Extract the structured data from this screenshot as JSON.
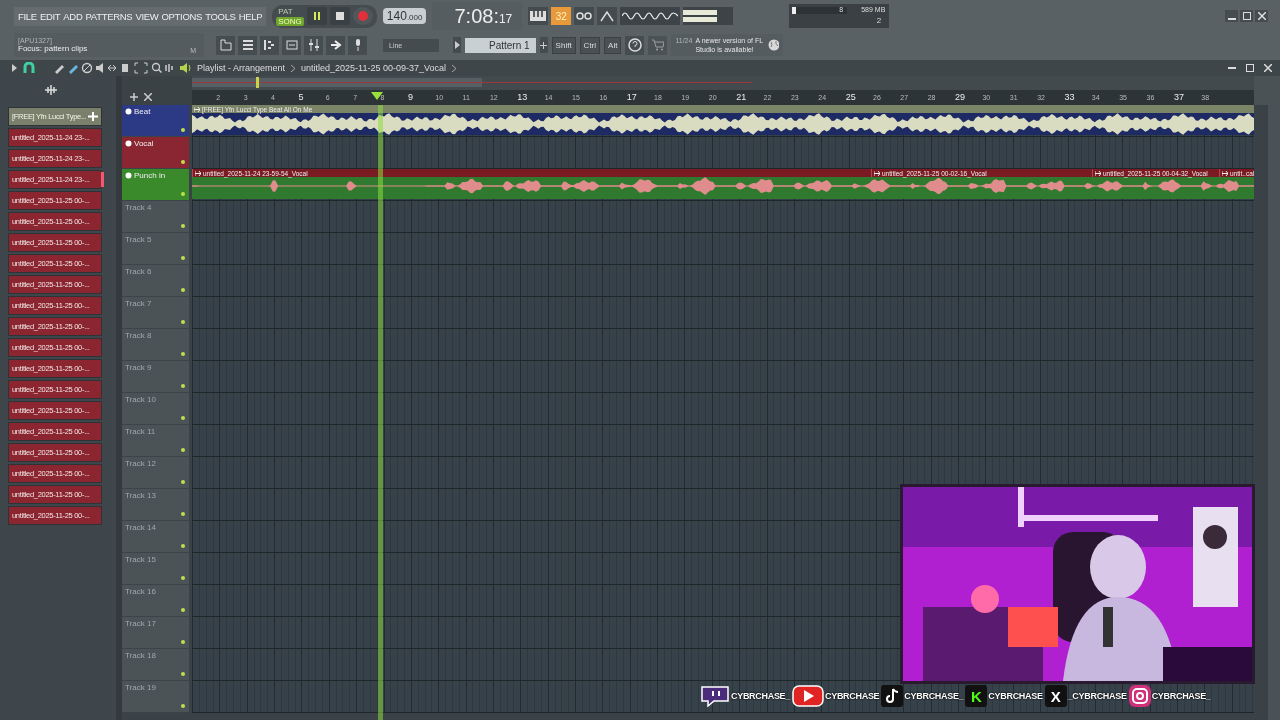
{
  "menu": [
    "FILE",
    "EDIT",
    "ADD",
    "PATTERNS",
    "VIEW",
    "OPTIONS",
    "TOOLS",
    "HELP"
  ],
  "mode": [
    {
      "label": "PAT",
      "selected": false
    },
    {
      "label": "SONG",
      "selected": true
    }
  ],
  "transport": {
    "playing": true
  },
  "tempo": "140",
  "tempo_decimals": ".000",
  "time": "7:08:",
  "time_small": "17",
  "snap_badge": "32",
  "cpu": {
    "voices": "8",
    "memory": "589 MB",
    "polyphony": "2",
    "level": 0.06
  },
  "hint": {
    "code": "[APU1327]",
    "text": "Focus: pattern clips",
    "mark": "M"
  },
  "snap": "Line",
  "pattern": "Pattern 1",
  "modifiers": [
    "Shift",
    "Ctrl",
    "Alt"
  ],
  "news": {
    "date": "11/24",
    "text": "A newer version of FL Studio is available!"
  },
  "playlist": {
    "title": "Playlist - Arrangement",
    "project": "untitled_2025-11-25 00-09-37_Vocal"
  },
  "picker": [
    {
      "label": "[FREE] Yfn Lucci Type...",
      "kind": "audio",
      "selected": false
    },
    {
      "label": "untitled_2025-11-24 23-...",
      "kind": "clip",
      "selected": false
    },
    {
      "label": "untitled_2025-11-24 23-...",
      "kind": "clip",
      "selected": false
    },
    {
      "label": "untitled_2025-11-24 23-...",
      "kind": "clip",
      "selected": true
    },
    {
      "label": "untitled_2025-11-25 00-...",
      "kind": "clip",
      "selected": false
    },
    {
      "label": "untitled_2025-11-25 00-...",
      "kind": "clip",
      "selected": false
    },
    {
      "label": "untitled_2025-11-25 00-...",
      "kind": "clip",
      "selected": false
    },
    {
      "label": "untitled_2025-11-25 00-...",
      "kind": "clip",
      "selected": false
    },
    {
      "label": "untitled_2025-11-25 00-...",
      "kind": "clip",
      "selected": false
    },
    {
      "label": "untitled_2025-11-25 00-...",
      "kind": "clip",
      "selected": false
    },
    {
      "label": "untitled_2025-11-25 00-...",
      "kind": "clip",
      "selected": false
    },
    {
      "label": "untitled_2025-11-25 00-...",
      "kind": "clip",
      "selected": false
    },
    {
      "label": "untitled_2025-11-25 00-...",
      "kind": "clip",
      "selected": false
    },
    {
      "label": "untitled_2025-11-25 00-...",
      "kind": "clip",
      "selected": false
    },
    {
      "label": "untitled_2025-11-25 00-...",
      "kind": "clip",
      "selected": false
    },
    {
      "label": "untitled_2025-11-25 00-...",
      "kind": "clip",
      "selected": false
    },
    {
      "label": "untitled_2025-11-25 00-...",
      "kind": "clip",
      "selected": false
    },
    {
      "label": "untitled_2025-11-25 00-...",
      "kind": "clip",
      "selected": false
    },
    {
      "label": "untitled_2025-11-25 00-...",
      "kind": "clip",
      "selected": false
    },
    {
      "label": "untitled_2025-11-25 00-...",
      "kind": "clip",
      "selected": false
    }
  ],
  "ruler": [
    "2",
    "3",
    "4",
    "5",
    "6",
    "7",
    "8",
    "9",
    "10",
    "11",
    "12",
    "13",
    "14",
    "15",
    "16",
    "17",
    "18",
    "19",
    "20",
    "21",
    "22",
    "23",
    "24",
    "25",
    "26",
    "27",
    "28",
    "29",
    "30",
    "31",
    "32",
    "33",
    "34",
    "35",
    "36",
    "37",
    "38"
  ],
  "tracks": [
    {
      "name": "Beat",
      "color": "#2c3a86",
      "clips": [
        {
          "label": "[FREE] Yfn Lucci Type Beat All On Me",
          "kind": "beat"
        }
      ]
    },
    {
      "name": "Vocal",
      "color": "#8a2632"
    },
    {
      "name": "Punch in",
      "color": "#3a8a2c",
      "clips": [
        {
          "label": "untitled_2025-11-24 23-59-54_Vocal",
          "kind": "vocal"
        },
        {
          "label": "untitled_2025-11-25 00-02-16_Vocal",
          "kind": "vocal"
        },
        {
          "label": "untitled_2025-11-25 00-04-32_Vocal",
          "kind": "vocal"
        },
        {
          "label": "untit..cal",
          "kind": "vocal"
        }
      ]
    },
    {
      "name": "Track 4"
    },
    {
      "name": "Track 5"
    },
    {
      "name": "Track 6"
    },
    {
      "name": "Track 7"
    },
    {
      "name": "Track 8"
    },
    {
      "name": "Track 9"
    },
    {
      "name": "Track 10"
    },
    {
      "name": "Track 11"
    },
    {
      "name": "Track 12"
    },
    {
      "name": "Track 13"
    },
    {
      "name": "Track 14"
    },
    {
      "name": "Track 15"
    },
    {
      "name": "Track 16"
    },
    {
      "name": "Track 17"
    },
    {
      "name": "Track 18"
    },
    {
      "name": "Track 19"
    }
  ],
  "webcam": {
    "kind": "picture"
  },
  "socials": [
    {
      "kind": "chat",
      "handle": "CYBRCHASE_"
    },
    {
      "kind": "play",
      "handle": "CYBRCHASE"
    },
    {
      "kind": "note",
      "handle": "CYBRCHASE_"
    },
    {
      "kind": "letter",
      "glyph": "K",
      "handle": "CYBRCHASE"
    },
    {
      "kind": "letter",
      "glyph": "X",
      "handle": "_CYBRCHASE"
    },
    {
      "kind": "camera",
      "handle": "CYBRCHASE_"
    }
  ]
}
